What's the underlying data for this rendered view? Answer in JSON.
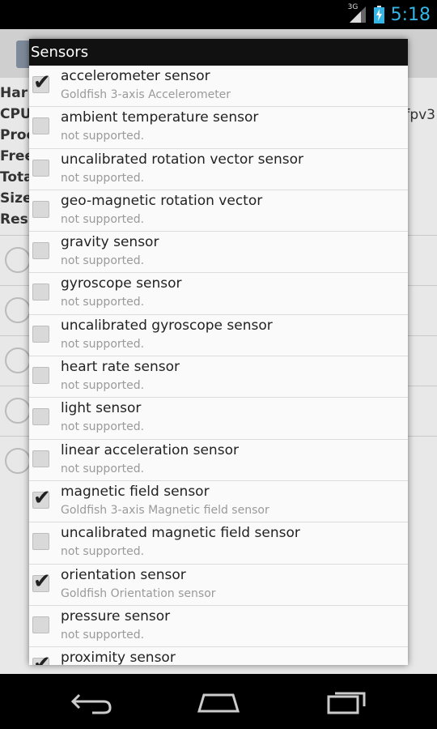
{
  "status_bar": {
    "network": "3G",
    "time": "5:18",
    "icons": [
      "signal-icon",
      "battery-charging-icon"
    ]
  },
  "background_app": {
    "labels": [
      "Har",
      "CPU",
      "Proc",
      "Free",
      "Tota",
      "Size",
      "Res"
    ],
    "right_fragment": "fpv3"
  },
  "dialog": {
    "title": "Sensors",
    "sensors": [
      {
        "name": "accelerometer sensor",
        "detail": "Goldfish 3-axis Accelerometer",
        "checked": true
      },
      {
        "name": "ambient temperature sensor",
        "detail": "not supported.",
        "checked": false
      },
      {
        "name": "uncalibrated rotation vector sensor",
        "detail": "not supported.",
        "checked": false
      },
      {
        "name": "geo-magnetic rotation vector",
        "detail": "not supported.",
        "checked": false
      },
      {
        "name": "gravity sensor",
        "detail": "not supported.",
        "checked": false
      },
      {
        "name": "gyroscope sensor",
        "detail": "not supported.",
        "checked": false
      },
      {
        "name": "uncalibrated gyroscope sensor",
        "detail": "not supported.",
        "checked": false
      },
      {
        "name": "heart rate sensor",
        "detail": "not supported.",
        "checked": false
      },
      {
        "name": "light sensor",
        "detail": "not supported.",
        "checked": false
      },
      {
        "name": "linear acceleration sensor",
        "detail": "not supported.",
        "checked": false
      },
      {
        "name": "magnetic field sensor",
        "detail": "Goldfish 3-axis Magnetic field sensor",
        "checked": true
      },
      {
        "name": "uncalibrated magnetic field sensor",
        "detail": "not supported.",
        "checked": false
      },
      {
        "name": "orientation sensor",
        "detail": "Goldfish Orientation sensor",
        "checked": true
      },
      {
        "name": "pressure sensor",
        "detail": "not supported.",
        "checked": false
      },
      {
        "name": "proximity sensor",
        "detail": "",
        "checked": true
      }
    ]
  },
  "nav_bar": {
    "buttons": [
      "back-icon",
      "home-icon",
      "recents-icon"
    ]
  },
  "colors": {
    "clock": "#33b5e5",
    "dialog_title_bg": "#111111",
    "detail_text": "#9a9a9a"
  }
}
